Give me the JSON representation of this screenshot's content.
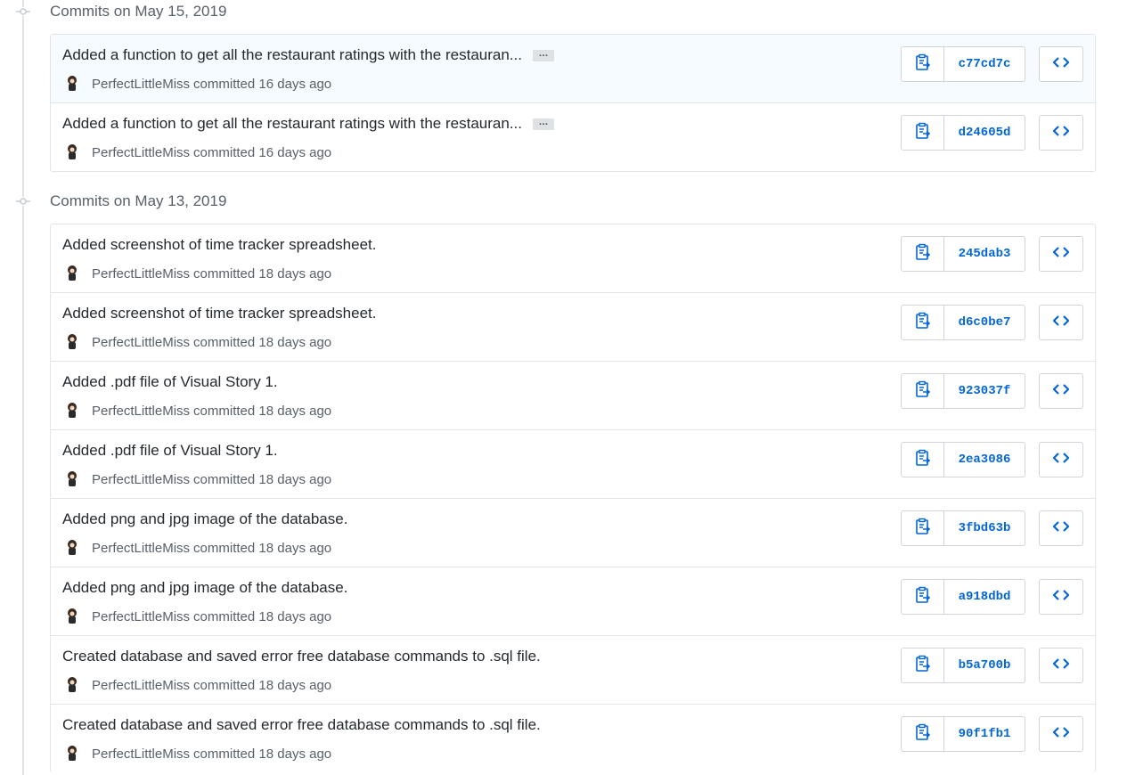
{
  "groups": [
    {
      "title": "Commits on May 15, 2019",
      "commits": [
        {
          "message": "Added a function to get all the restaurant ratings with the restauran...",
          "author": "PerfectLittleMiss",
          "action": "committed",
          "time": "16 days ago",
          "sha": "c77cd7c",
          "ellipsis": "…",
          "highlight": true
        },
        {
          "message": "Added a function to get all the restaurant ratings with the restauran...",
          "author": "PerfectLittleMiss",
          "action": "committed",
          "time": "16 days ago",
          "sha": "d24605d",
          "ellipsis": "…",
          "highlight": false
        }
      ]
    },
    {
      "title": "Commits on May 13, 2019",
      "commits": [
        {
          "message": "Added screenshot of time tracker spreadsheet.",
          "author": "PerfectLittleMiss",
          "action": "committed",
          "time": "18 days ago",
          "sha": "245dab3"
        },
        {
          "message": "Added screenshot of time tracker spreadsheet.",
          "author": "PerfectLittleMiss",
          "action": "committed",
          "time": "18 days ago",
          "sha": "d6c0be7"
        },
        {
          "message": "Added .pdf file of Visual Story 1.",
          "author": "PerfectLittleMiss",
          "action": "committed",
          "time": "18 days ago",
          "sha": "923037f"
        },
        {
          "message": "Added .pdf file of Visual Story 1.",
          "author": "PerfectLittleMiss",
          "action": "committed",
          "time": "18 days ago",
          "sha": "2ea3086"
        },
        {
          "message": "Added png and jpg image of the database.",
          "author": "PerfectLittleMiss",
          "action": "committed",
          "time": "18 days ago",
          "sha": "3fbd63b"
        },
        {
          "message": "Added png and jpg image of the database.",
          "author": "PerfectLittleMiss",
          "action": "committed",
          "time": "18 days ago",
          "sha": "a918dbd"
        },
        {
          "message": "Created database and saved error free database commands to .sql file.",
          "author": "PerfectLittleMiss",
          "action": "committed",
          "time": "18 days ago",
          "sha": "b5a700b"
        },
        {
          "message": "Created database and saved error free database commands to .sql file.",
          "author": "PerfectLittleMiss",
          "action": "committed",
          "time": "18 days ago",
          "sha": "90f1fb1"
        }
      ]
    }
  ],
  "icons": {
    "timeline": "git-commit-icon",
    "copy": "clipboard-icon",
    "browse": "code-icon",
    "avatar": "avatar"
  },
  "colors": {
    "link": "#0366d6",
    "text": "#24292e",
    "muted": "#586069",
    "border": "#e1e4e8",
    "highlight": "#f6fbff"
  }
}
